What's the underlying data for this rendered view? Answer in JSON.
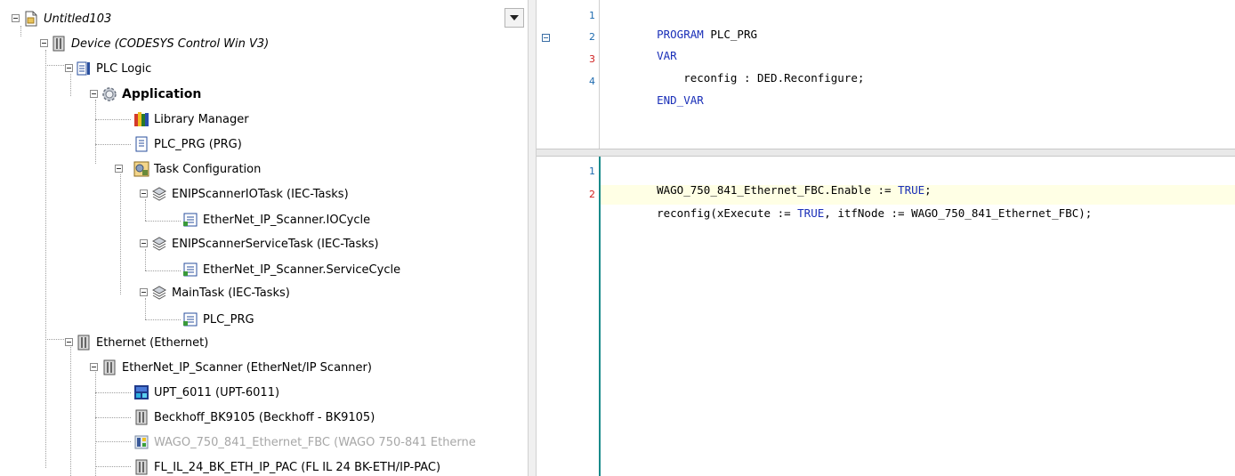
{
  "tree": {
    "items": [
      {
        "id": "project",
        "label": "Untitled103",
        "icon": "project-file-icon"
      },
      {
        "id": "device",
        "label": "Device (CODESYS Control Win V3)",
        "icon": "device-icon"
      },
      {
        "id": "plc-logic",
        "label": "PLC Logic",
        "icon": "plc-logic-icon"
      },
      {
        "id": "application",
        "label": "Application",
        "icon": "application-gear-icon"
      },
      {
        "id": "library-manager",
        "label": "Library Manager",
        "icon": "library-books-icon"
      },
      {
        "id": "plc-prg",
        "label": "PLC_PRG (PRG)",
        "icon": "pou-document-icon"
      },
      {
        "id": "task-config",
        "label": "Task Configuration",
        "icon": "task-configuration-icon"
      },
      {
        "id": "enip-io-task",
        "label": "ENIPScannerIOTask (IEC-Tasks)",
        "icon": "task-icon"
      },
      {
        "id": "io-cycle",
        "label": "EtherNet_IP_Scanner.IOCycle",
        "icon": "task-call-icon"
      },
      {
        "id": "enip-service-task",
        "label": "ENIPScannerServiceTask (IEC-Tasks)",
        "icon": "task-icon"
      },
      {
        "id": "service-cycle",
        "label": "EtherNet_IP_Scanner.ServiceCycle",
        "icon": "task-call-icon"
      },
      {
        "id": "main-task",
        "label": "MainTask (IEC-Tasks)",
        "icon": "task-icon"
      },
      {
        "id": "main-plc-prg",
        "label": "PLC_PRG",
        "icon": "task-call-icon"
      },
      {
        "id": "ethernet",
        "label": "Ethernet (Ethernet)",
        "icon": "device-icon"
      },
      {
        "id": "enip-scanner",
        "label": "EtherNet_IP_Scanner (EtherNet/IP Scanner)",
        "icon": "device-icon"
      },
      {
        "id": "upt",
        "label": "UPT_6011 (UPT-6011)",
        "icon": "module-blue-icon"
      },
      {
        "id": "beckhoff",
        "label": "Beckhoff_BK9105 (Beckhoff - BK9105)",
        "icon": "device-icon"
      },
      {
        "id": "wago",
        "label": "WAGO_750_841_Ethernet_FBC (WAGO 750-841 Etherne",
        "icon": "wago-device-icon"
      },
      {
        "id": "fl-il",
        "label": "FL_IL_24_BK_ETH_IP_PAC (FL IL 24 BK-ETH/IP-PAC)",
        "icon": "device-icon"
      }
    ]
  },
  "declaration": {
    "lines": [
      {
        "num": "1",
        "tokens": [
          {
            "t": "PROGRAM",
            "c": "kw"
          },
          {
            "t": " PLC_PRG",
            "c": "pl"
          }
        ]
      },
      {
        "num": "2",
        "tokens": [
          {
            "t": "VAR",
            "c": "kw"
          }
        ]
      },
      {
        "num": "3",
        "tokens": [
          {
            "t": "    reconfig : DED.Reconfigure;",
            "c": "pl"
          }
        ]
      },
      {
        "num": "4",
        "tokens": [
          {
            "t": "END_VAR",
            "c": "kw"
          }
        ]
      }
    ]
  },
  "implementation": {
    "lines": [
      {
        "num": "1",
        "tokens": [
          {
            "t": "WAGO_750_841_Ethernet_FBC.Enable := ",
            "c": "pl"
          },
          {
            "t": "TRUE",
            "c": "kw"
          },
          {
            "t": ";",
            "c": "pl"
          }
        ]
      },
      {
        "num": "2",
        "tokens": [
          {
            "t": "reconfig(xExecute := ",
            "c": "pl"
          },
          {
            "t": "TRUE",
            "c": "kw"
          },
          {
            "t": ", itfNode := WAGO_750_841_Ethernet_FBC);",
            "c": "pl"
          }
        ]
      }
    ]
  },
  "colors": {
    "keyword": "#1a2fb8",
    "line_number": "#1e6bb0",
    "modified_line_number": "#d02020",
    "current_line_highlight": "#ffffe5",
    "disabled_text": "#a7a7a7"
  }
}
